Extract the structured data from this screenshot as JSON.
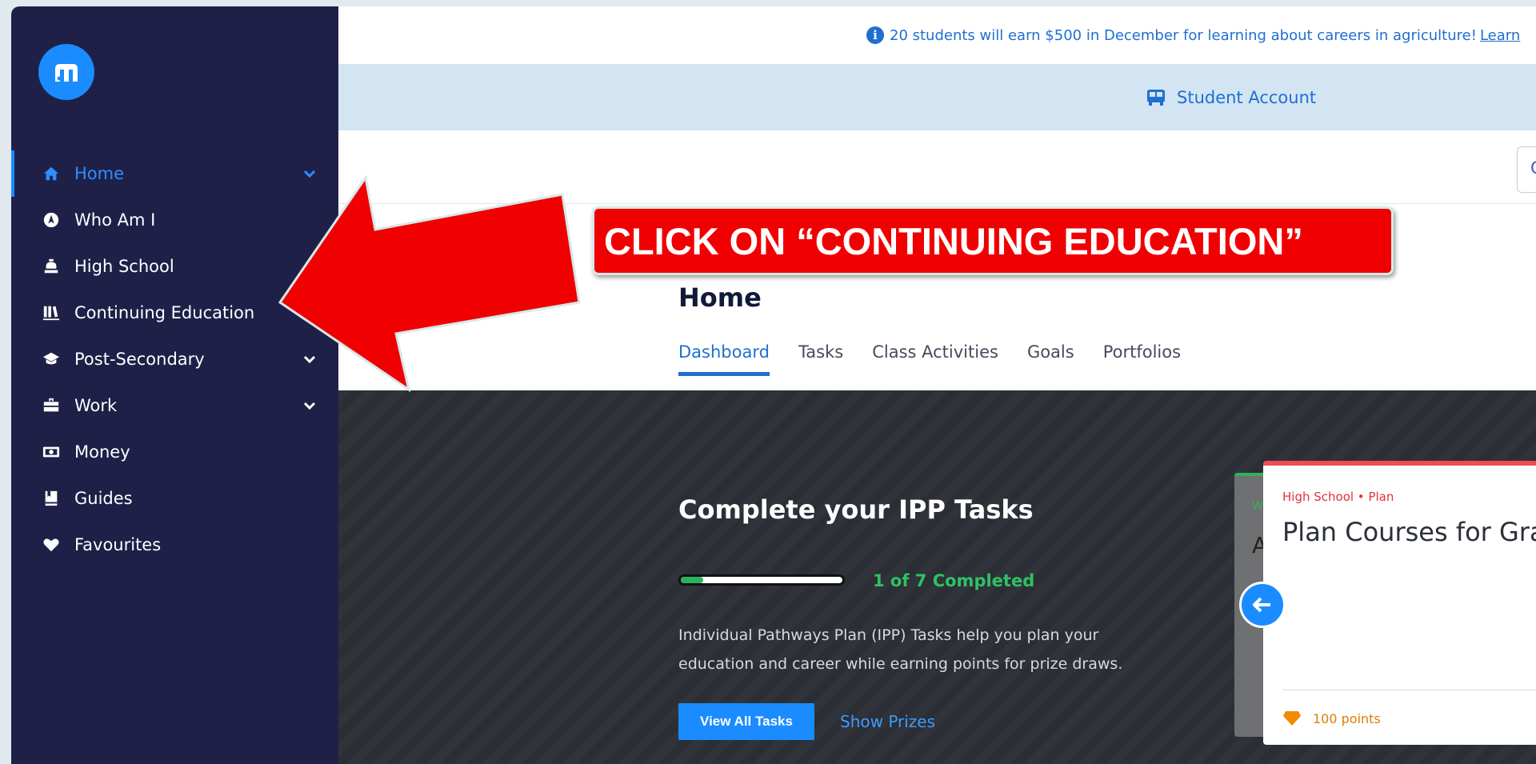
{
  "banner": {
    "text": "20 students will earn $500 in December for learning about careers in agriculture!",
    "link": "Learn"
  },
  "account": {
    "label": "Student Account"
  },
  "toolbar": {
    "input_fragment": "C"
  },
  "sidebar": {
    "items": [
      {
        "label": "Home",
        "icon": "home-icon",
        "active": true,
        "has_chevron": true
      },
      {
        "label": "Who Am I",
        "icon": "compass-icon"
      },
      {
        "label": "High School",
        "icon": "school-bell-icon"
      },
      {
        "label": "Continuing Education",
        "icon": "books-icon"
      },
      {
        "label": "Post-Secondary",
        "icon": "graduation-cap-icon",
        "has_chevron": true
      },
      {
        "label": "Work",
        "icon": "briefcase-icon",
        "has_chevron": true
      },
      {
        "label": "Money",
        "icon": "money-icon"
      },
      {
        "label": "Guides",
        "icon": "guide-book-icon"
      },
      {
        "label": "Favourites",
        "icon": "heart-icon"
      }
    ]
  },
  "page": {
    "title": "Home",
    "tabs": [
      {
        "label": "Dashboard",
        "active": true
      },
      {
        "label": "Tasks"
      },
      {
        "label": "Class Activities"
      },
      {
        "label": "Goals"
      },
      {
        "label": "Portfolios"
      }
    ]
  },
  "hero": {
    "title": "Complete your IPP Tasks",
    "progress_fraction": 0.14,
    "progress_text": "1 of 7 Completed",
    "description": "Individual Pathways Plan (IPP) Tasks help you plan your education and career while earning points for prize draws.",
    "primary_button": "View All Tasks",
    "secondary_link": "Show Prizes"
  },
  "cards": {
    "back_category_fragment": "W",
    "back_title_fragment": "A",
    "front": {
      "category": "High School • Plan",
      "title": "Plan Courses for Gra",
      "points": "100 points"
    }
  },
  "annotation": {
    "callout": "CLICK ON “CONTINUING EDUCATION”"
  },
  "colors": {
    "sidebar_bg": "#1f2048",
    "accent": "#1a8cff",
    "callout_red": "#f00000",
    "progress_green": "#2fc163"
  }
}
